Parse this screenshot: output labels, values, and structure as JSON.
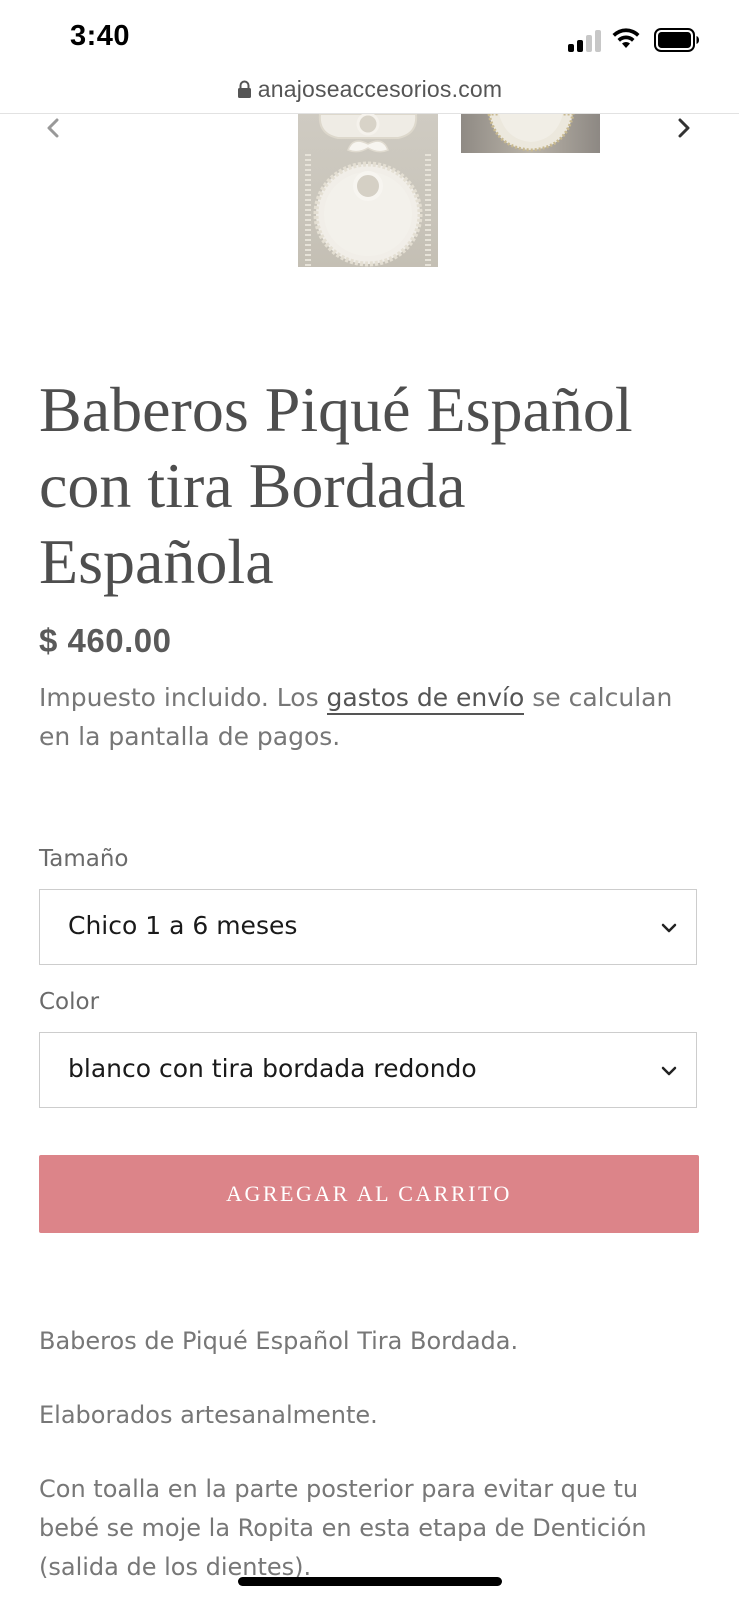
{
  "status_bar": {
    "time": "3:40"
  },
  "browser": {
    "url": "anajoseaccesorios.com"
  },
  "product": {
    "title": "Baberos Piqué Español con tira Bordada Española",
    "price": "$ 460.00",
    "tax_note_prefix": "Impuesto incluido. Los ",
    "shipping_link": "gastos de envío",
    "tax_note_suffix": " se calculan en la pantalla de pagos."
  },
  "options": {
    "size_label": "Tamaño",
    "size_value": "Chico 1 a 6 meses",
    "color_label": "Color",
    "color_value": "blanco con tira bordada redondo"
  },
  "cart": {
    "add_label": "AGREGAR AL CARRITO",
    "button_color": "#dc8489"
  },
  "description": {
    "p1": "Baberos de Piqué Español Tira Bordada.",
    "p2": "Elaborados artesanalmente.",
    "p3": "Con toalla en la parte posterior para evitar que tu bebé se moje la Ropita en esta etapa de Dentición (salida de los dientes)."
  },
  "icons": {
    "lock": "lock-icon",
    "prev": "chevron-left-icon",
    "next": "chevron-right-icon",
    "dropdown": "chevron-down-icon"
  }
}
